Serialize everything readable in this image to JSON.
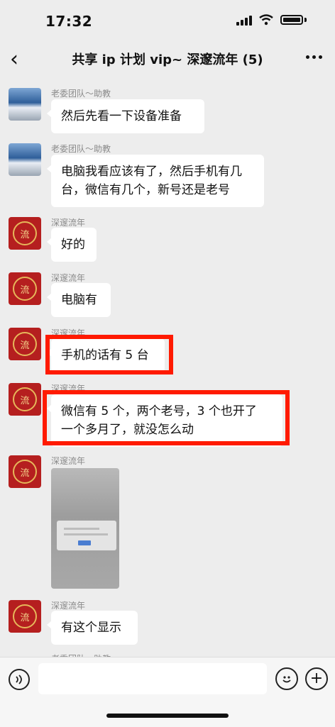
{
  "status_bar": {
    "time": "17:32"
  },
  "header": {
    "title": "共享 ip 计划 vip~ 深邃流年 (5)",
    "back_icon": "back-chevron-icon",
    "more_icon": "more-dots-icon"
  },
  "messages": [
    {
      "sender": "老委团队～助教",
      "text": "然后先看一下设备准备"
    },
    {
      "sender": "老委团队～助教",
      "text_line1": "电脑我看应该有了，然后手机有几",
      "text_line2": "台，微信有几个，新号还是老号"
    },
    {
      "sender": "深邃流年",
      "text": "好的"
    },
    {
      "sender": "深邃流年",
      "text": "电脑有"
    },
    {
      "sender": "深邃流年",
      "text": "手机的话有 5 台"
    },
    {
      "sender": "深邃流年",
      "text_line1": "微信有 5 个，两个老号，3 个也开了",
      "text_line2": "一个多月了，就没怎么动"
    },
    {
      "sender": "深邃流年",
      "image": "photo-message"
    },
    {
      "sender": "深邃流年",
      "text": "有这个显示"
    }
  ],
  "partial_sender": "老委团队～助教",
  "input_bar": {
    "placeholder": "",
    "voice_icon": "voice-icon",
    "emoji_icon": "emoji-icon",
    "plus_icon": "plus-icon"
  },
  "colors": {
    "background": "#ededed",
    "highlight": "#ff1a00",
    "bubble": "#ffffff"
  }
}
